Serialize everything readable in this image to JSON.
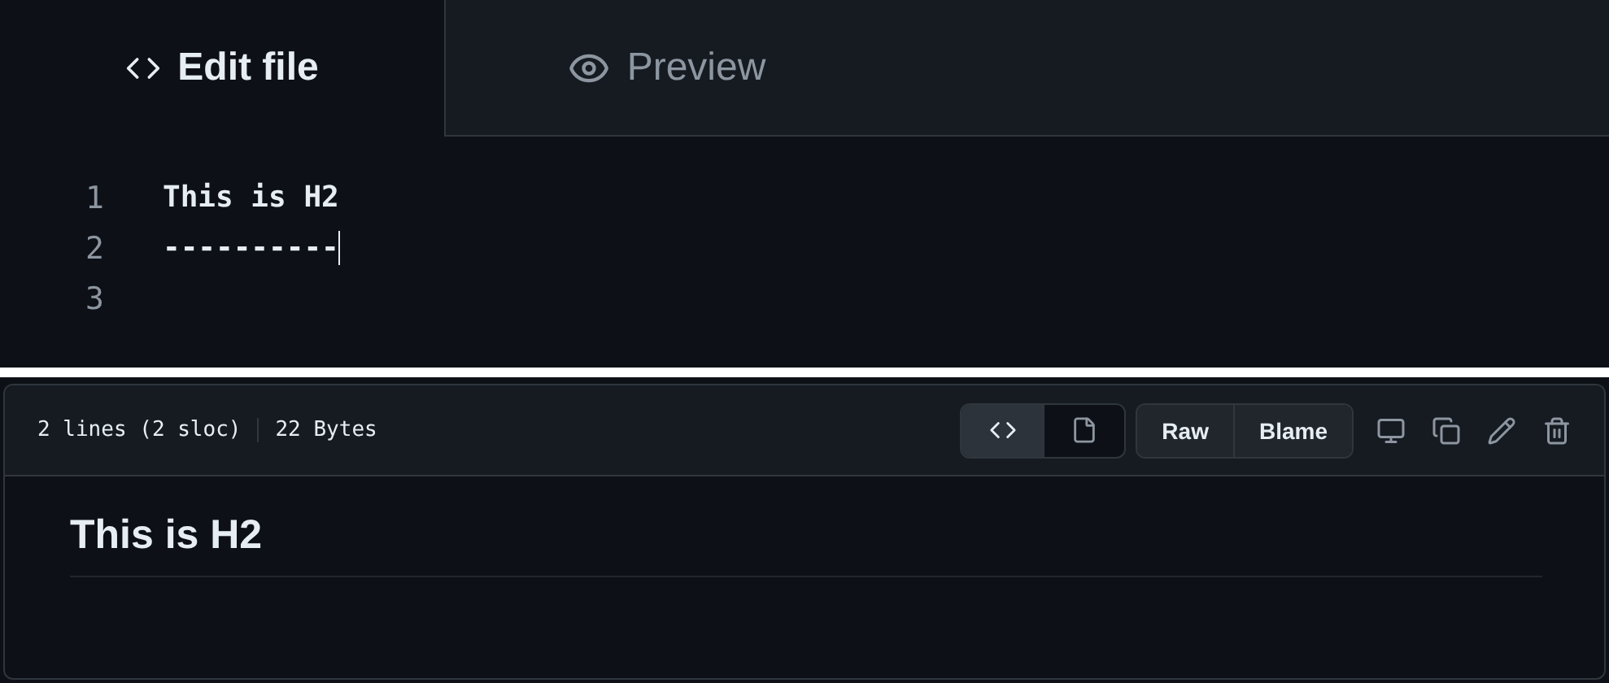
{
  "editor_tabs": [
    {
      "label": "Edit file",
      "selected": true
    },
    {
      "label": "Preview",
      "selected": false
    }
  ],
  "editor": {
    "lines": [
      {
        "number": "1",
        "text": "This is H2"
      },
      {
        "number": "2",
        "text": "----------",
        "cursor": true
      },
      {
        "number": "3"
      }
    ]
  },
  "file_header": {
    "line_count": "2 lines (2 sloc)",
    "size": "22 Bytes",
    "view_toggle": [
      {
        "kind": "code",
        "selected": true
      },
      {
        "kind": "file",
        "selected": false
      }
    ],
    "buttons": [
      "Raw",
      "Blame"
    ],
    "actions": [
      {
        "kind": "desktop"
      },
      {
        "kind": "copy"
      },
      {
        "kind": "edit"
      },
      {
        "kind": "delete"
      }
    ]
  },
  "preview": {
    "heading": "This is H2"
  }
}
